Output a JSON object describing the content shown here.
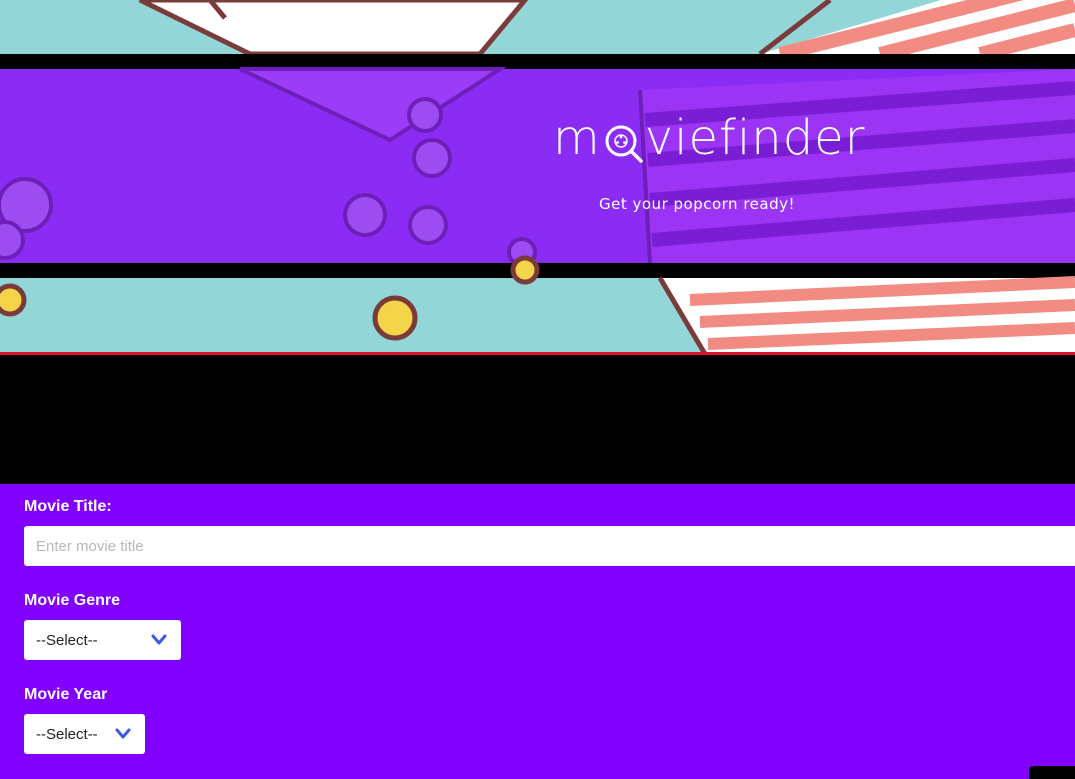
{
  "header": {
    "logo_prefix": "m",
    "logo_suffix": "viefinder",
    "tagline": "Get your popcorn ready!",
    "colors": {
      "purple_band": "#8b2cf5",
      "teal_bg": "#93d6d8",
      "stripe_red": "#f28b82",
      "accent_line": "#e0102a"
    }
  },
  "form": {
    "background": "#8200fe",
    "title_label": "Movie Title:",
    "title_placeholder": "Enter movie title",
    "title_value": "",
    "genre_label": "Movie Genre",
    "genre_selected": "--Select--",
    "year_label": "Movie Year",
    "year_selected": "--Select--",
    "chevron_icon": "chevron-down-icon"
  }
}
